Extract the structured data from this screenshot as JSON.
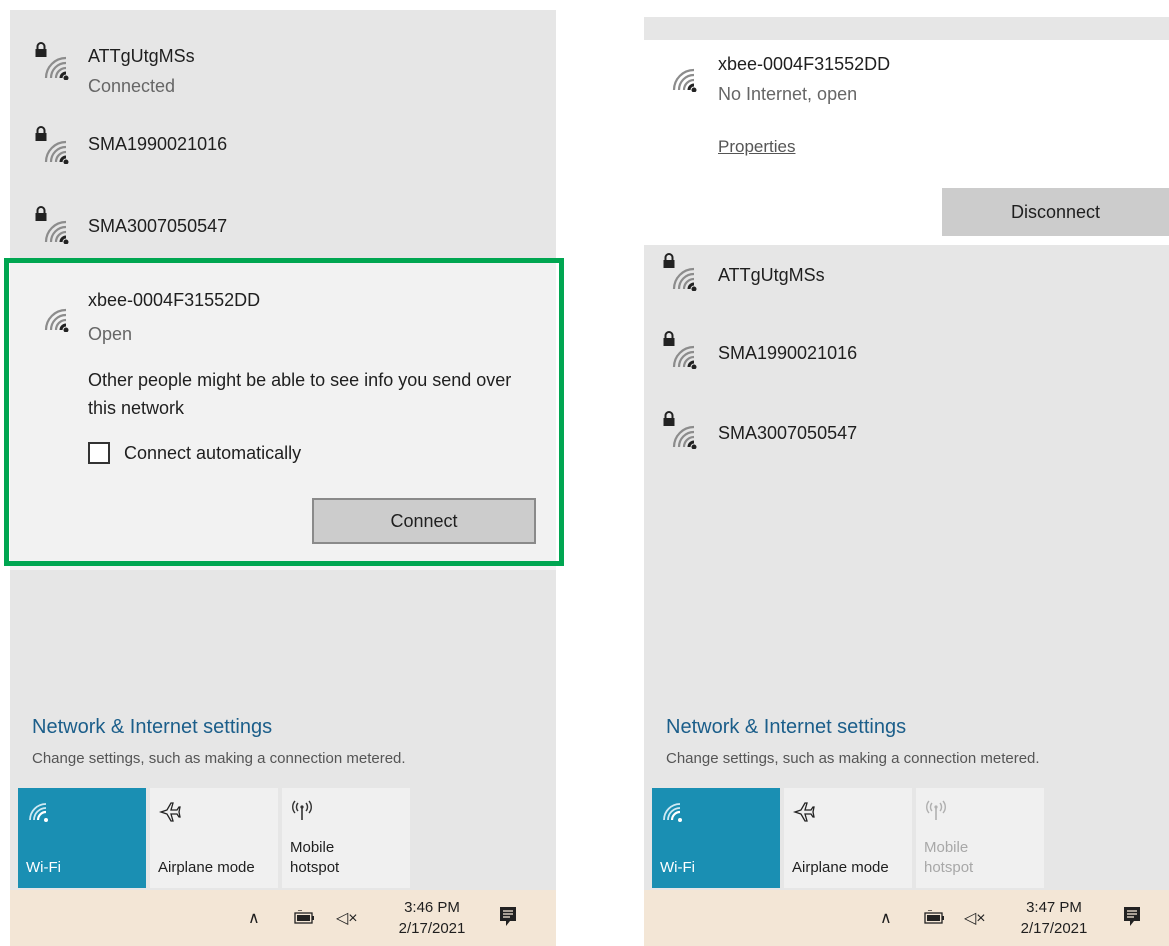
{
  "left": {
    "networks": [
      {
        "name": "ATTgUtgMSs",
        "status": "Connected"
      },
      {
        "name": "SMA1990021016"
      },
      {
        "name": "SMA3007050547"
      }
    ],
    "selected": {
      "name": "xbee-0004F31552DD",
      "status": "Open",
      "warning": "Other people might be able to see info you send over this network",
      "auto_connect_label": "Connect automatically",
      "auto_connect_checked": false,
      "button_label": "Connect"
    },
    "settings": {
      "title": "Network & Internet settings",
      "description": "Change settings, such as making a connection metered."
    },
    "tiles": [
      {
        "label": "Wi-Fi",
        "state": "active",
        "icon": "wifi-icon"
      },
      {
        "label": "Airplane mode",
        "state": "inactive",
        "icon": "airplane-icon"
      },
      {
        "label_line1": "Mobile",
        "label_line2": "hotspot",
        "state": "inactive",
        "icon": "hotspot-icon"
      }
    ],
    "taskbar": {
      "time": "3:46 PM",
      "date": "2/17/2021"
    }
  },
  "right": {
    "connected": {
      "name": "xbee-0004F31552DD",
      "status": "No Internet, open",
      "properties_label": "Properties",
      "button_label": "Disconnect"
    },
    "networks": [
      {
        "name": "ATTgUtgMSs"
      },
      {
        "name": "SMA1990021016"
      },
      {
        "name": "SMA3007050547"
      }
    ],
    "settings": {
      "title": "Network & Internet settings",
      "description": "Change settings, such as making a connection metered."
    },
    "tiles": [
      {
        "label": "Wi-Fi",
        "state": "active",
        "icon": "wifi-icon"
      },
      {
        "label": "Airplane mode",
        "state": "inactive",
        "icon": "airplane-icon"
      },
      {
        "label_line1": "Mobile",
        "label_line2": "hotspot",
        "state": "disabled",
        "icon": "hotspot-icon"
      }
    ],
    "taskbar": {
      "time": "3:47 PM",
      "date": "2/17/2021"
    }
  },
  "colors": {
    "highlight": "#00a651",
    "tile_active": "#1a8fb3",
    "link": "#1b5e8a",
    "taskbar": "#f3e6d6"
  }
}
